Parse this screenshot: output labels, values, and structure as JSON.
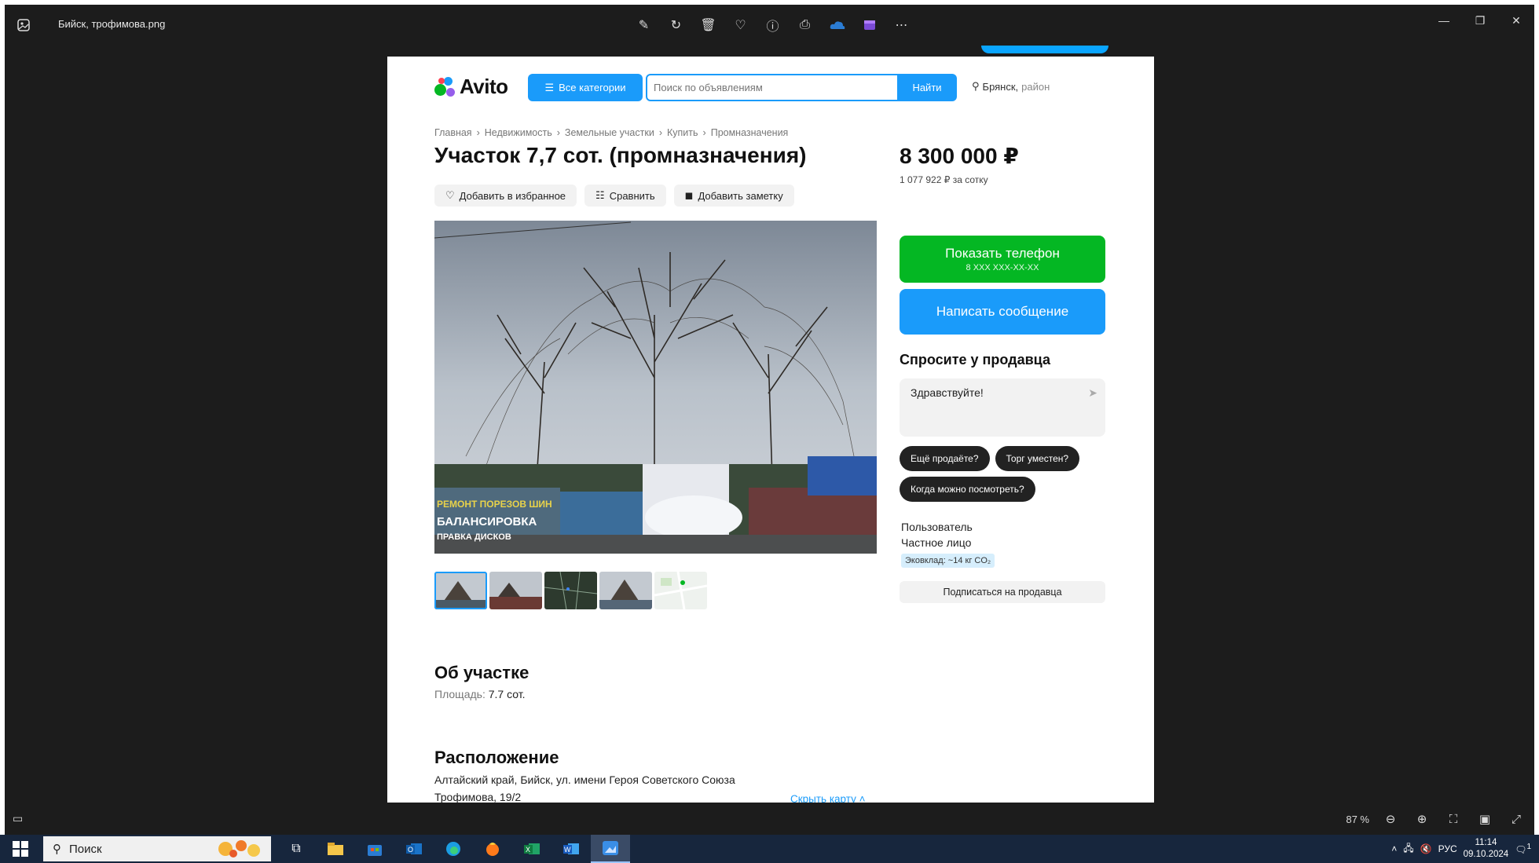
{
  "window": {
    "title": "Бийск, трофимова.png",
    "tools": [
      "edit-icon",
      "rotate-icon",
      "delete-icon",
      "favorite-icon",
      "info-icon",
      "print-icon",
      "onedrive-icon",
      "clipchamp-icon",
      "more-icon"
    ]
  },
  "avito": {
    "logo": "Avito",
    "categories_button": "Все категории",
    "search_placeholder": "Поиск по объявлениям",
    "find_button": "Найти",
    "location_city": "Брянск,",
    "location_area": "район",
    "breadcrumbs": [
      "Главная",
      "Недвижимость",
      "Земельные участки",
      "Купить",
      "Промназначения"
    ],
    "breadcrumb_sep": "›",
    "title": "Участок 7,7 сот. (промназначения)",
    "price": "8 300 000 ₽",
    "price_per": "1 077 922 ₽ за сотку",
    "actions": {
      "favorite": "Добавить в избранное",
      "compare": "Сравнить",
      "note": "Добавить заметку"
    },
    "show_phone": "Показать телефон",
    "phone_mask": "8 XXX XXX-XX-XX",
    "write_message": "Написать сообщение",
    "ask_title": "Спросите у продавца",
    "ask_text": "Здравствуйте!",
    "chips": [
      "Ещё продаёте?",
      "Торг уместен?",
      "Когда можно посмотреть?"
    ],
    "seller_name": "Пользователь",
    "seller_type": "Частное лицо",
    "eco_badge": "Эковклад: ~14 кг CO₂",
    "subscribe": "Подписаться на продавца",
    "about_title": "Об участке",
    "area_label": "Площадь:",
    "area_value": "7.7 сот.",
    "location_title": "Расположение",
    "address_line1": "Алтайский край, Бийск, ул. имени Героя Советского Союза",
    "address_line2": "Трофимова, 19/2",
    "hide_map": "Скрыть карту ˄",
    "photo_signs": [
      "РЕМОНТ ПОРЕЗОВ ШИН",
      "БАЛАНСИРОВКА",
      "ПРАВКА ДИСКОВ"
    ]
  },
  "statusbar": {
    "zoom": "87 %"
  },
  "taskbar": {
    "search": "Поиск",
    "lang": "РУС",
    "time": "11:14",
    "date": "09.10.2024",
    "notif_count": "1"
  }
}
